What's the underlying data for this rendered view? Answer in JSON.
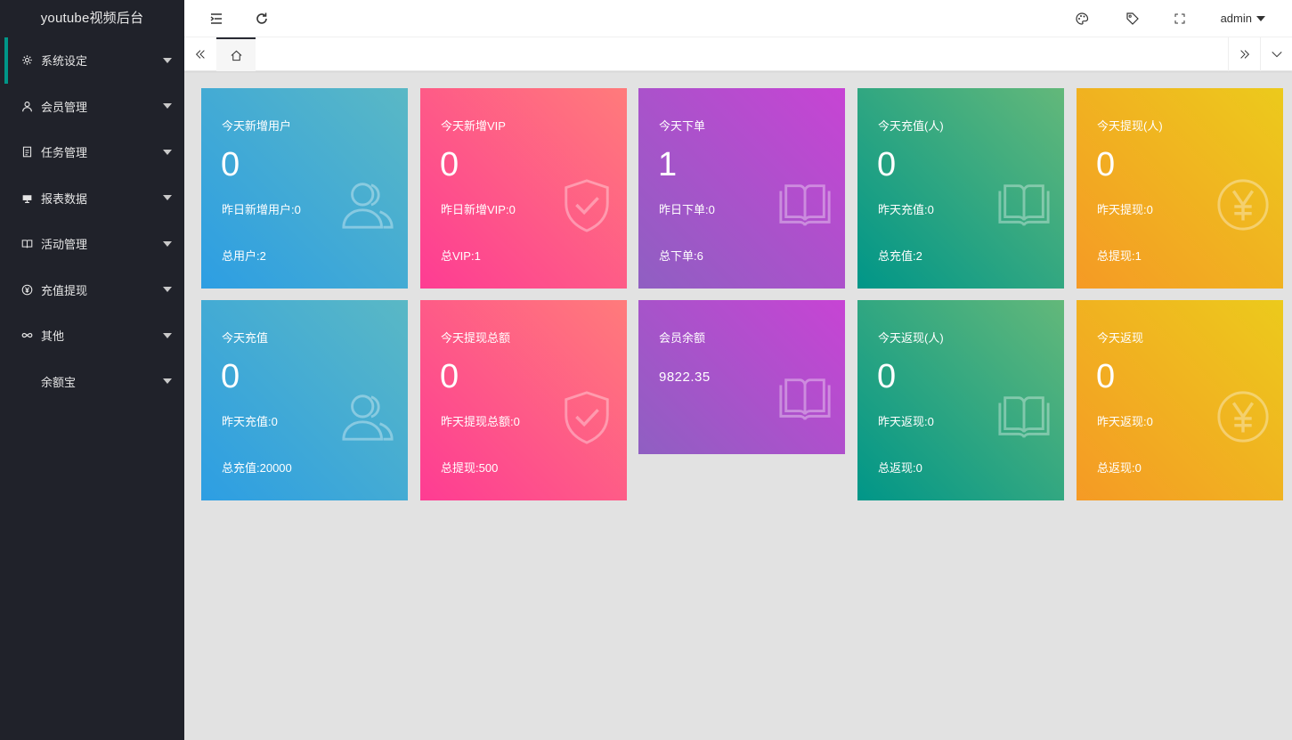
{
  "app": {
    "title": "youtube视频后台"
  },
  "sidebar": {
    "items": [
      {
        "label": "系统设定",
        "icon": "gear-icon"
      },
      {
        "label": "会员管理",
        "icon": "user-icon"
      },
      {
        "label": "任务管理",
        "icon": "file-icon"
      },
      {
        "label": "报表数据",
        "icon": "chart-icon"
      },
      {
        "label": "活动管理",
        "icon": "book-icon"
      },
      {
        "label": "充值提现",
        "icon": "yen-icon"
      },
      {
        "label": "其他",
        "icon": "link-icon"
      },
      {
        "label": "余额宝",
        "icon": ""
      }
    ]
  },
  "header": {
    "user": "admin"
  },
  "colors": {
    "sidebar_bg": "#20222a",
    "accent": "#009688",
    "content_bg": "#e2e2e2"
  },
  "cards": [
    {
      "title": "今天新增用户",
      "value": "0",
      "sub": "昨日新增用户:0",
      "total": "总用户:2",
      "icon": "users-icon",
      "color": "blue"
    },
    {
      "title": "今天新增VIP",
      "value": "0",
      "sub": "昨日新增VIP:0",
      "total": "总VIP:1",
      "icon": "shield-check-icon",
      "color": "pink"
    },
    {
      "title": "今天下单",
      "value": "1",
      "sub": "昨日下单:0",
      "total": "总下单:6",
      "icon": "book-icon",
      "color": "purple"
    },
    {
      "title": "今天充值(人)",
      "value": "0",
      "sub": "昨天充值:0",
      "total": "总充值:2",
      "icon": "book-icon",
      "color": "green"
    },
    {
      "title": "今天提现(人)",
      "value": "0",
      "sub": "昨天提现:0",
      "total": "总提现:1",
      "icon": "yen-circle-icon",
      "color": "yellow"
    },
    {
      "title": "今天充值",
      "value": "0",
      "sub": "昨天充值:0",
      "total": "总充值:20000",
      "icon": "users-icon",
      "color": "blue"
    },
    {
      "title": "今天提现总额",
      "value": "0",
      "sub": "昨天提现总额:0",
      "total": "总提现:500",
      "icon": "shield-check-icon",
      "color": "pink"
    },
    {
      "title": "会员余额",
      "amount": "9822.35",
      "icon": "book-icon",
      "color": "purple"
    },
    {
      "title": "今天返现(人)",
      "value": "0",
      "sub": "昨天返现:0",
      "total": "总返现:0",
      "icon": "book-icon",
      "color": "green"
    },
    {
      "title": "今天返现",
      "value": "0",
      "sub": "昨天返现:0",
      "total": "总返现:0",
      "icon": "yen-circle-icon",
      "color": "yellow"
    }
  ]
}
